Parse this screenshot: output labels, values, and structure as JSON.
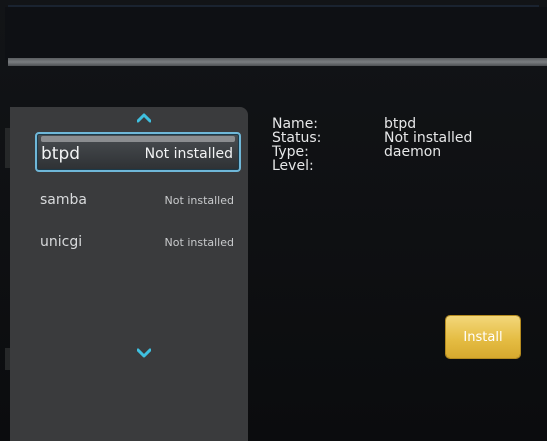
{
  "package_list": {
    "items": [
      {
        "name": "btpd",
        "status": "Not installed",
        "selected": true
      },
      {
        "name": "samba",
        "status": "Not installed",
        "selected": false
      },
      {
        "name": "unicgi",
        "status": "Not installed",
        "selected": false
      }
    ],
    "scroll_up_icon": "chevron-up-icon",
    "scroll_down_icon": "chevron-down-icon"
  },
  "details": {
    "name_label": "Name:",
    "name_value": "btpd",
    "status_label": "Status:",
    "status_value": "Not installed",
    "type_label": "Type:",
    "type_value": "daemon",
    "level_label": "Level:",
    "level_value": ""
  },
  "actions": {
    "install_label": "Install"
  },
  "colors": {
    "accent_cyan": "#3fc0e0",
    "selection_border": "#6fb7d8",
    "install_button": "#e5bd44",
    "panel": "#3a3b3d",
    "background": "#0b0c0e"
  }
}
